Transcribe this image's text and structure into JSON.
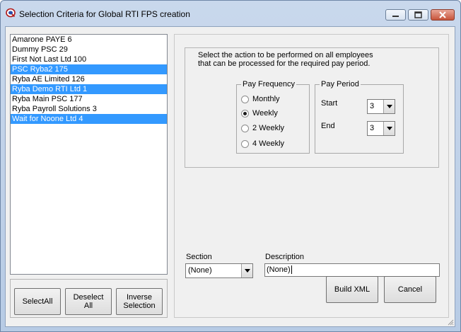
{
  "window": {
    "title": "Selection Criteria for Global RTI FPS creation",
    "icon": "app-logo-icon",
    "controls": [
      "minimize-icon",
      "maximize-icon",
      "close-icon"
    ]
  },
  "companies": [
    {
      "label": "Amarone PAYE 6",
      "selected": false
    },
    {
      "label": "Dummy PSC 29",
      "selected": false
    },
    {
      "label": "First Not Last Ltd 100",
      "selected": false
    },
    {
      "label": "PSC Ryba2 175",
      "selected": true
    },
    {
      "label": "Ryba AE Limited 126",
      "selected": false
    },
    {
      "label": "Ryba Demo RTI Ltd 1",
      "selected": true
    },
    {
      "label": "Ryba Main PSC 177",
      "selected": false
    },
    {
      "label": "Ryba Payroll Solutions 3",
      "selected": false
    },
    {
      "label": "Wait for Noone Ltd 4",
      "selected": true
    }
  ],
  "list_buttons": {
    "select_all": "SelectAll",
    "deselect_line1": "Deselect",
    "deselect_line2": "All",
    "inverse_line1": "Inverse",
    "inverse_line2": "Selection"
  },
  "action": {
    "instruction_line1": "Select the action to be performed on all employees",
    "instruction_line2": "that can be processed for the required pay period."
  },
  "pay_frequency": {
    "label": "Pay Frequency",
    "options": [
      "Monthly",
      "Weekly",
      "2 Weekly",
      "4 Weekly"
    ],
    "selected": "Weekly"
  },
  "pay_period": {
    "label": "Pay Period",
    "start_label": "Start",
    "start_value": "3",
    "end_label": "End",
    "end_value": "3"
  },
  "section": {
    "label": "Section",
    "value": "(None)"
  },
  "description": {
    "label": "Description",
    "value": "(None)"
  },
  "buttons": {
    "build_xml": "Build XML",
    "cancel": "Cancel"
  },
  "colors": {
    "selection": "#3399ff",
    "dialog_bg": "#f0f0f0",
    "title_bar": "#c9d8ec"
  }
}
